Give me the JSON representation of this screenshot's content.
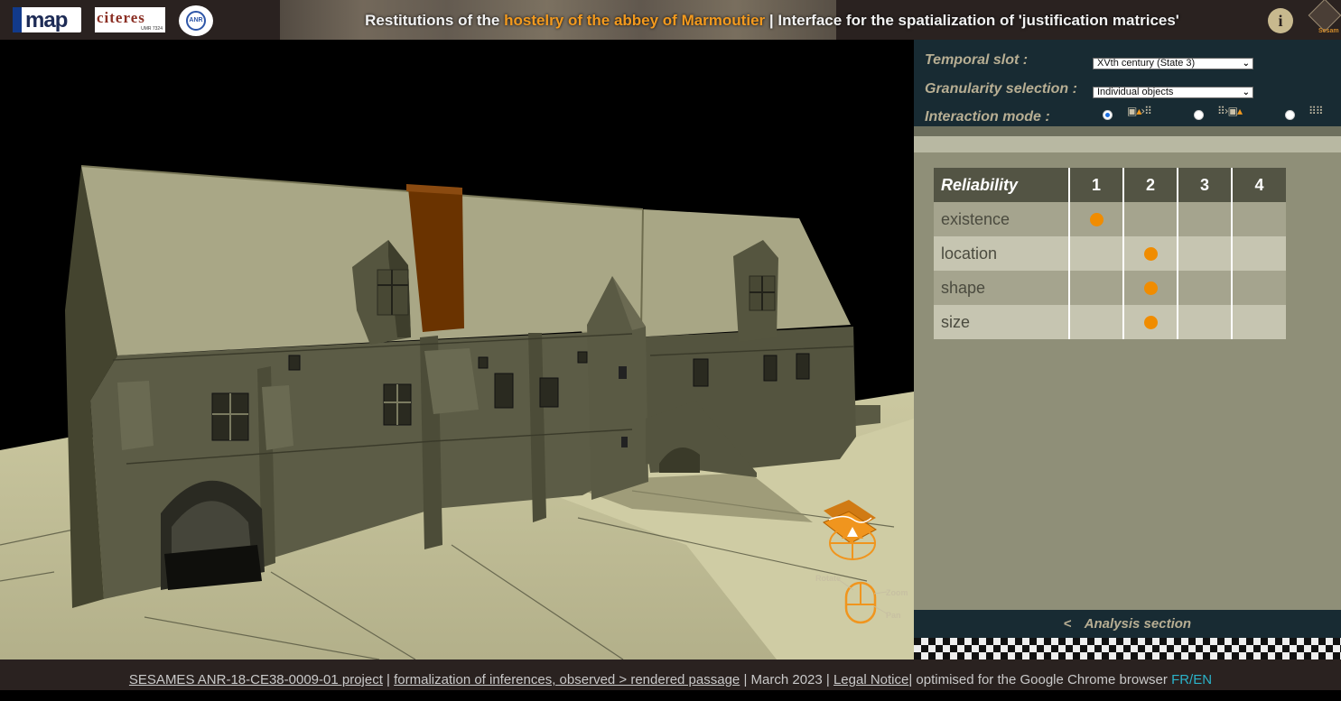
{
  "header": {
    "title_prefix": "Restitutions of the ",
    "title_highlight": "hostelry of the abbey of Marmoutier",
    "title_suffix": " | Interface for the spatialization of 'justification matrices'",
    "info_label": "i",
    "logo_left_1": "map",
    "logo_left_2": "citeres",
    "logo_left_2_sub": "UMR 7324",
    "logo_left_3": "ANR",
    "logo_right": "Sesam"
  },
  "controls": {
    "temporal_label": "Temporal slot :",
    "temporal_value": "XVth century (State 3)",
    "granularity_label": "Granularity selection :",
    "granularity_value": "Individual objects",
    "interaction_label": "Interaction mode :"
  },
  "navigation": {
    "rotate_label": "Rotate",
    "zoom_label": "Zoom",
    "pan_label": "Pan"
  },
  "reliability_table": {
    "header": "Reliability",
    "columns": [
      "1",
      "2",
      "3",
      "4"
    ],
    "rows": [
      {
        "label": "existence",
        "level": 1
      },
      {
        "label": "location",
        "level": 2
      },
      {
        "label": "shape",
        "level": 2
      },
      {
        "label": "size",
        "level": 2
      }
    ]
  },
  "analysis_section": {
    "arrow": "<",
    "label": "Analysis section"
  },
  "footer": {
    "project": "SESAMES ANR-18-CE38-0009-01 project",
    "sep1": " | ",
    "formalization": "formalization of inferences, observed > rendered passage",
    "sep2": " | March 2023 | ",
    "legal": "Legal Notice",
    "browser": "| optimised for the Google Chrome browser ",
    "lang": "FR/EN"
  },
  "colors": {
    "accent": "#f39a1e",
    "dot": "#f08c00",
    "panel_dark": "#182b33",
    "panel_body": "#8f8f78",
    "building": "#54543f",
    "roof": "#a8a685",
    "chimney": "#6a3300",
    "ground": "#b0ae88"
  }
}
